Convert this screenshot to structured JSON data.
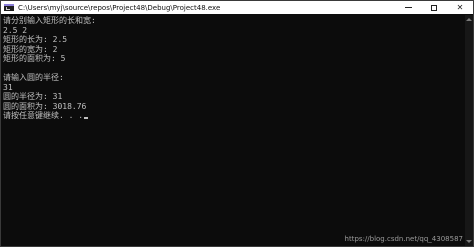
{
  "window": {
    "title": "C:\\Users\\myj\\source\\repos\\Project48\\Debug\\Project48.exe",
    "controls": {
      "minimize": "minimize-icon",
      "maximize": "maximize-icon",
      "close_label": "✕"
    }
  },
  "console": {
    "lines": [
      "请分别输入矩形的长和宽:",
      "2.5 2",
      "矩形的长为: 2.5",
      "矩形的宽为: 2",
      "矩形的面积为: 5",
      "",
      "请输入圆的半径:",
      "31",
      "圆的半径为: 31",
      "圆的面积为: 3018.76",
      "请按任意键继续. . ."
    ],
    "text_color": "#c0c0c0",
    "background": "#0c0c0c"
  },
  "watermark": "https://blog.csdn.net/qq_4308587"
}
